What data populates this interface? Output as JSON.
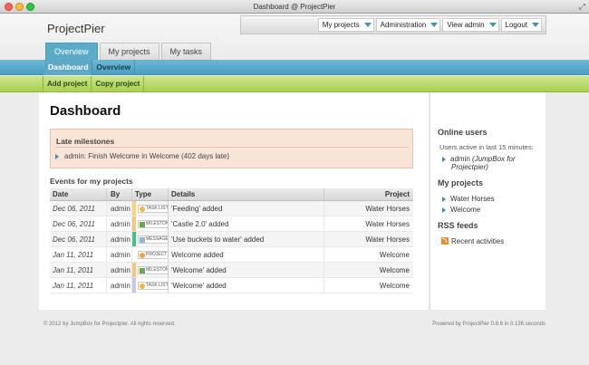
{
  "window": {
    "title": "Dashboard @ ProjectPier"
  },
  "header": {
    "logo": "ProjectPier",
    "menu": [
      {
        "label": "My projects"
      },
      {
        "label": "Administration"
      },
      {
        "label": "View admin"
      },
      {
        "label": "Logout"
      }
    ],
    "tabs": [
      {
        "label": "Overview"
      },
      {
        "label": "My projects"
      },
      {
        "label": "My tasks"
      }
    ]
  },
  "subtabs": [
    {
      "label": "Dashboard"
    },
    {
      "label": "Overview"
    }
  ],
  "actions": [
    {
      "label": "Add project"
    },
    {
      "label": "Copy project"
    }
  ],
  "main": {
    "title": "Dashboard",
    "milestones": {
      "title": "Late milestones",
      "items": [
        {
          "user": "admin",
          "sep": ": ",
          "text": "Finish Welcome",
          "in": " in ",
          "project": "Welcome",
          "late": " (402 days late)"
        }
      ]
    },
    "events": {
      "title": "Events for my projects",
      "columns": {
        "date": "Date",
        "by": "By",
        "type": "Type",
        "details": "Details",
        "project": "Project"
      },
      "rows": [
        {
          "date": "Dec 06, 2011",
          "by": "admin",
          "type": "TASK LIST",
          "details": "'Feeding' added",
          "project": "Water Horses"
        },
        {
          "date": "Dec 06, 2011",
          "by": "admin",
          "type": "MILESTONE",
          "details": "'Castle 2.0' added",
          "project": "Water Horses"
        },
        {
          "date": "Dec 06, 2011",
          "by": "admin",
          "type": "MESSAGE",
          "details": "'Use buckets to water' added",
          "project": "Water Horses"
        },
        {
          "date": "Jan 11, 2011",
          "by": "admin",
          "type": "PROJECT",
          "details": "Welcome added",
          "project": "Welcome"
        },
        {
          "date": "Jan 11, 2011",
          "by": "admin",
          "type": "MILESTONE",
          "details": "'Welcome' added",
          "project": "Welcome"
        },
        {
          "date": "Jan 11, 2011",
          "by": "admin",
          "type": "TASK LIST",
          "details": "'Welcome' added",
          "project": "Welcome"
        }
      ]
    }
  },
  "sidebar": {
    "online": {
      "title": "Online users",
      "subtitle": "Users active in last 15 minutes:",
      "user": "admin",
      "user_note": "(JumpBox for",
      "user_note2": "Projectpier)"
    },
    "projects": {
      "title": "My projects",
      "items": [
        {
          "label": "Water Horses"
        },
        {
          "label": "Welcome"
        }
      ]
    },
    "rss": {
      "title": "RSS feeds",
      "item": "Recent activities"
    }
  },
  "footer": {
    "left": "© 2012 by JumpBox for Projectpier. All rights reserved.",
    "right": "Powered by ProjectPier 0.8.6 in 0.136 seconds"
  },
  "colors": {
    "accent_blue": "#4a9fc0",
    "accent_green": "#a9cf52",
    "task_list": "#f3d47a",
    "milestone": "#f7c67a",
    "message": "#3fc48a",
    "project": "#ffffff"
  }
}
